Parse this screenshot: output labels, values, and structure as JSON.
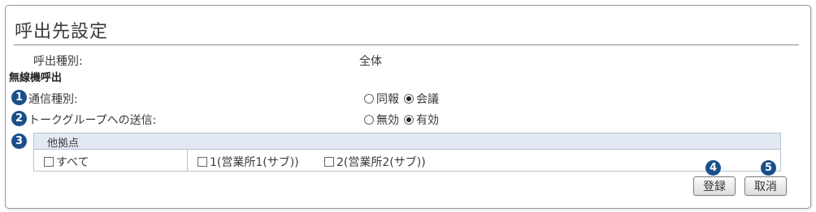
{
  "title": "呼出先設定",
  "call_type": {
    "label": "呼出種別:",
    "value": "全体"
  },
  "wireless_section_label": "無線機呼出",
  "badges": [
    "1",
    "2",
    "3",
    "4",
    "5"
  ],
  "comm_type": {
    "label": "通信種別:",
    "options": [
      {
        "label": "同報",
        "selected": false
      },
      {
        "label": "会議",
        "selected": true
      }
    ]
  },
  "talk_group": {
    "label": "トークグループへの送信:",
    "options": [
      {
        "label": "無効",
        "selected": false
      },
      {
        "label": "有効",
        "selected": true
      }
    ]
  },
  "other_locations": {
    "header": "他拠点",
    "all_label": "すべて",
    "items": [
      {
        "label": "1(営業所1(サブ))",
        "checked": false
      },
      {
        "label": "2(営業所2(サブ))",
        "checked": false
      }
    ]
  },
  "buttons": {
    "register": "登録",
    "cancel": "取消"
  },
  "colors": {
    "badge": "#1a4f8a",
    "table_header": "#e3e9f3",
    "table_border": "#b5c2d4"
  }
}
